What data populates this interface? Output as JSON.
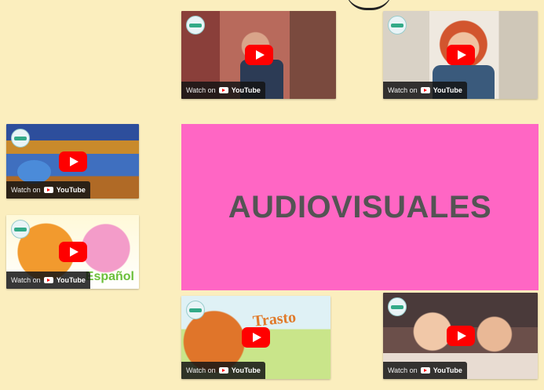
{
  "page": {
    "background": "#fbeebe",
    "title": "AUDIOVISUALES",
    "title_color": "#545454",
    "panel_color": "#ff66c4"
  },
  "videos": [
    {
      "id": "v1",
      "watch_label": "Watch on",
      "platform": "YouTube",
      "play_icon": "play-icon"
    },
    {
      "id": "v2",
      "watch_label": "Watch on",
      "platform": "YouTube",
      "play_icon": "play-icon"
    },
    {
      "id": "v3",
      "watch_label": "Watch on",
      "platform": "YouTube",
      "play_icon": "play-icon"
    },
    {
      "id": "v4",
      "watch_label": "Watch on",
      "platform": "YouTube",
      "play_icon": "play-icon"
    },
    {
      "id": "v5",
      "watch_label": "Watch on",
      "platform": "YouTube",
      "play_icon": "play-icon"
    },
    {
      "id": "v6",
      "watch_label": "Watch on",
      "platform": "YouTube",
      "play_icon": "play-icon"
    }
  ],
  "colors": {
    "play_button": "#ff0000",
    "watch_bar": "#141414"
  }
}
